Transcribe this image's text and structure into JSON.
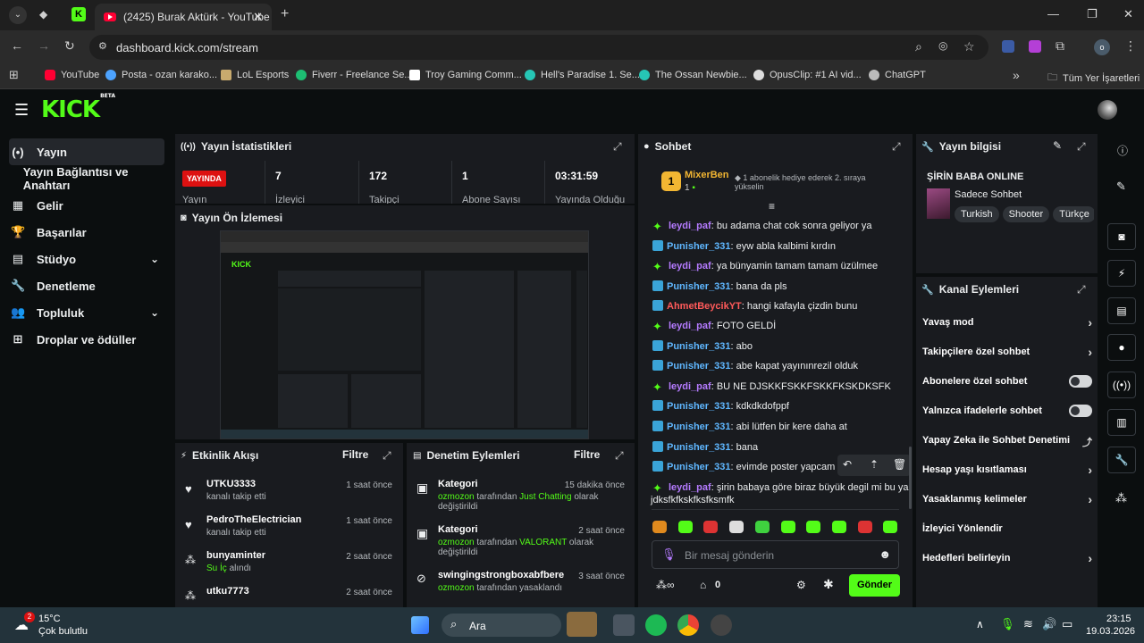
{
  "browser": {
    "tab_title": "(2425) Burak Aktürk - YouTube",
    "url": "dashboard.kick.com/stream",
    "bookmarks": [
      "YouTube",
      "Posta - ozan karako...",
      "LoL Esports",
      "Fiverr - Freelance Se...",
      "Troy Gaming Comm...",
      "Hell's Paradise 1. Se...",
      "The Ossan Newbie...",
      "OpusClip: #1 AI vid...",
      "ChatGPT"
    ],
    "all_bookmarks": "Tüm Yer İşaretleri",
    "profile_letter": "o"
  },
  "logo": {
    "text": "KICK",
    "beta": "BETA"
  },
  "sidebar": {
    "items": [
      {
        "label": "Yayın",
        "icon": "(•)"
      },
      {
        "label": "Yayın Bağlantısı ve Anahtarı",
        "icon": ""
      },
      {
        "label": "Gelir",
        "icon": "▦"
      },
      {
        "label": "Başarılar",
        "icon": "🏆"
      },
      {
        "label": "Stüdyo",
        "icon": "▤"
      },
      {
        "label": "Denetleme",
        "icon": "🔧"
      },
      {
        "label": "Topluluk",
        "icon": "👥"
      },
      {
        "label": "Droplar ve ödüller",
        "icon": "⊞"
      }
    ]
  },
  "stats": {
    "title": "Yayın İstatistikleri",
    "live_label": "YAYINDA",
    "live_sub": "Yayın",
    "items": [
      {
        "value": "7",
        "label": "İzleyici"
      },
      {
        "value": "172",
        "label": "Takipçi"
      },
      {
        "value": "1",
        "label": "Abone Sayısı"
      },
      {
        "value": "03:31:59",
        "label": "Yayında Olduğu"
      }
    ]
  },
  "preview": {
    "title": "Yayın Ön İzlemesi"
  },
  "activity": {
    "title": "Etkinlik Akışı",
    "filter": "Filtre",
    "items": [
      {
        "name": "UTKU3333",
        "sub": "kanalı takip etti",
        "time": "1 saat önce"
      },
      {
        "name": "PedroTheElectrician",
        "sub": "kanalı takip etti",
        "time": "1 saat önce"
      },
      {
        "name": "bunyaminter",
        "sub_pre": "",
        "sub_hl": "Su İç",
        "sub_post": " alındı",
        "time": "2 saat önce"
      },
      {
        "name": "utku7773",
        "sub": "",
        "time": "2 saat önce"
      }
    ]
  },
  "moderation": {
    "title": "Denetim Eylemleri",
    "filter": "Filtre",
    "items": [
      {
        "name": "Kategori",
        "time": "15 dakika önce",
        "user": "ozmozon",
        "pre": " tarafından ",
        "hl": "Just Chatting",
        "post": " olarak değiştirildi"
      },
      {
        "name": "Kategori",
        "time": "2 saat önce",
        "user": "ozmozon",
        "pre": " tarafından ",
        "hl": "VALORANT",
        "post": " olarak değiştirildi"
      },
      {
        "name": "swingingstrongboxabfbere",
        "time": "3 saat önce",
        "user": "ozmozon",
        "pre": " tarafından yasaklandı",
        "hl": "",
        "post": ""
      }
    ]
  },
  "chat": {
    "title": "Sohbet",
    "pinned_user": "MixerBen",
    "pinned_count": "1",
    "pinned_text": "1 abonelik hediye ederek 2. sıraya yükselin",
    "messages": [
      {
        "user": "leydi_paf",
        "text": "bu adama chat cok sonra geliyor ya",
        "color": "#b57bff",
        "badge": "diamond"
      },
      {
        "user": "Punisher_331",
        "text": "eyw abla kalbimi kırdın",
        "color": "#5fb7ff",
        "badge": "sword"
      },
      {
        "user": "leydi_paf",
        "text": "ya bünyamin tamam tamam üzülmee",
        "color": "#b57bff",
        "badge": "diamond"
      },
      {
        "user": "Punisher_331",
        "text": "bana da pls",
        "color": "#5fb7ff",
        "badge": "sword"
      },
      {
        "user": "AhmetBeycikYT",
        "text": "hangi kafayla çizdin bunu",
        "color": "#ff5a5a",
        "badge": "sword"
      },
      {
        "user": "leydi_paf",
        "text": "FOTO GELDİ",
        "color": "#b57bff",
        "badge": "diamond"
      },
      {
        "user": "Punisher_331",
        "text": "abo",
        "color": "#5fb7ff",
        "badge": "sword"
      },
      {
        "user": "Punisher_331",
        "text": "abe kapat yayınınrezil olduk",
        "color": "#5fb7ff",
        "badge": "sword"
      },
      {
        "user": "leydi_paf",
        "text": "BU NE DJSKKFSKKFSKKFKSKDKSFK",
        "color": "#b57bff",
        "badge": "diamond"
      },
      {
        "user": "Punisher_331",
        "text": "kdkdkdofppf",
        "color": "#5fb7ff",
        "badge": "sword"
      },
      {
        "user": "Punisher_331",
        "text": "abi lütfen bir kere daha at",
        "color": "#5fb7ff",
        "badge": "sword"
      },
      {
        "user": "Punisher_331",
        "text": "bana",
        "color": "#5fb7ff",
        "badge": "sword"
      },
      {
        "user": "Punisher_331",
        "text": "evimde poster yapcam",
        "color": "#5fb7ff",
        "badge": "sword"
      },
      {
        "user": "leydi_paf",
        "text": "şirin babaya göre biraz büyük degil mi bu ya",
        "text2": "jdksfkfkskfksfksmfk",
        "color": "#b57bff",
        "badge": "diamond"
      }
    ],
    "input_placeholder": "Bir mesaj gönderin",
    "points": "0",
    "send": "Gönder"
  },
  "stream_info": {
    "title": "Yayın bilgisi",
    "stream_title": "ŞİRİN BABA ONLINE",
    "category": "Sadece Sohbet",
    "tags": [
      "Turkish",
      "Shooter",
      "Türkçe"
    ]
  },
  "channel_actions": {
    "title": "Kanal Eylemleri",
    "items": [
      {
        "label": "Yavaş mod",
        "type": "chevron"
      },
      {
        "label": "Takipçilere özel sohbet",
        "type": "chevron"
      },
      {
        "label": "Abonelere özel sohbet",
        "type": "toggle"
      },
      {
        "label": "Yalnızca ifadelerle sohbet",
        "type": "toggle"
      },
      {
        "label": "Yapay Zeka ile Sohbet Denetimi",
        "type": "external"
      },
      {
        "label": "Hesap yaşı kısıtlaması",
        "type": "chevron"
      },
      {
        "label": "Yasaklanmış kelimeler",
        "type": "chevron"
      },
      {
        "label": "İzleyici Yönlendir",
        "type": "none"
      },
      {
        "label": "Hedefleri belirleyin",
        "type": "chevron"
      }
    ]
  },
  "taskbar": {
    "temp": "15°C",
    "weather": "Çok bulutlu",
    "weather_badge": "2",
    "search": "Ara",
    "time": "23:15",
    "date": "19.03.2026"
  },
  "colors": {
    "accent": "#53fc18",
    "bg": "#0b0e0f",
    "panel": "#191b1f"
  }
}
